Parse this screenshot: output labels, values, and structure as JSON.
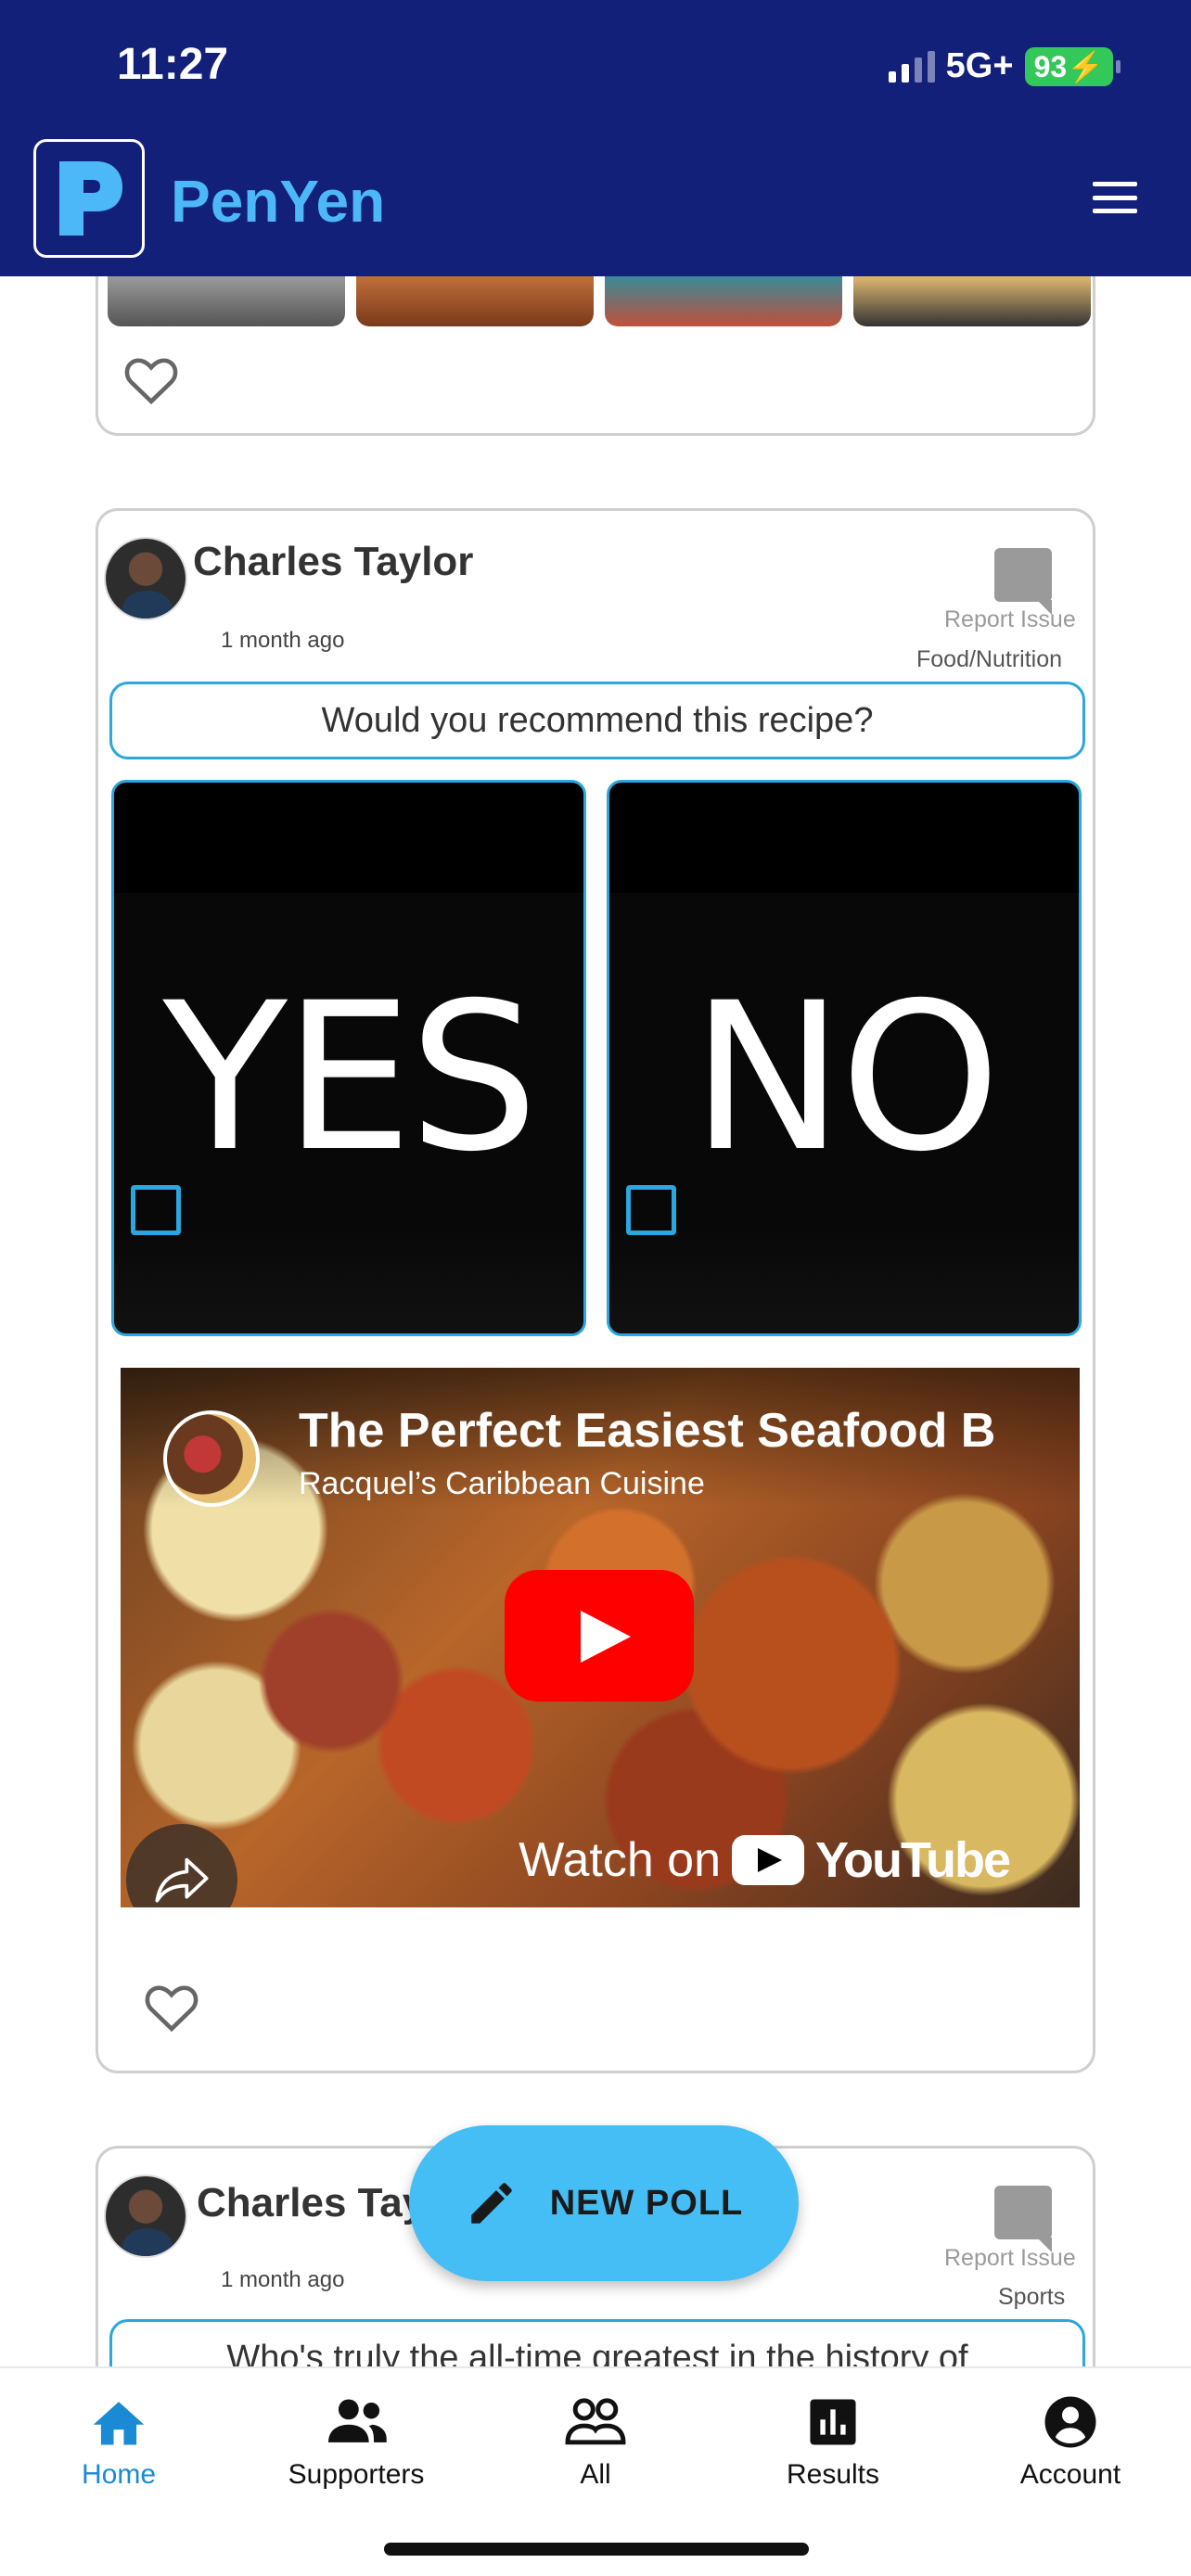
{
  "status_bar": {
    "time": "11:27",
    "network": "5G+",
    "battery": "93"
  },
  "app": {
    "name": "PenYen"
  },
  "posts": [
    {
      "author": "Charles Taylor",
      "time_ago": "1 month ago",
      "report_label": "Report Issue",
      "category": "Food/Nutrition",
      "question": "Would you recommend this recipe?",
      "options": [
        "YES",
        "NO"
      ],
      "video": {
        "title": "The Perfect Easiest Seafood B",
        "channel": "Racquel’s Caribbean Cuisine",
        "watch_on": "Watch on",
        "platform": "YouTube"
      }
    },
    {
      "author": "Charles Taylor",
      "time_ago": "1 month ago",
      "report_label": "Report Issue",
      "category": "Sports",
      "question": "Who's truly the all-time greatest in the history of"
    }
  ],
  "fab": {
    "label": "NEW POLL"
  },
  "nav": [
    {
      "label": "Home",
      "icon": "home-icon",
      "active": true
    },
    {
      "label": "Supporters",
      "icon": "supporters-icon"
    },
    {
      "label": "All",
      "icon": "all-icon"
    },
    {
      "label": "Results",
      "icon": "results-icon"
    },
    {
      "label": "Account",
      "icon": "account-icon"
    }
  ],
  "colors": {
    "header": "#13207a",
    "accent": "#2ca6de",
    "fab": "#45bef5",
    "brand": "#4db8f7",
    "active_nav": "#1a8ad4"
  }
}
